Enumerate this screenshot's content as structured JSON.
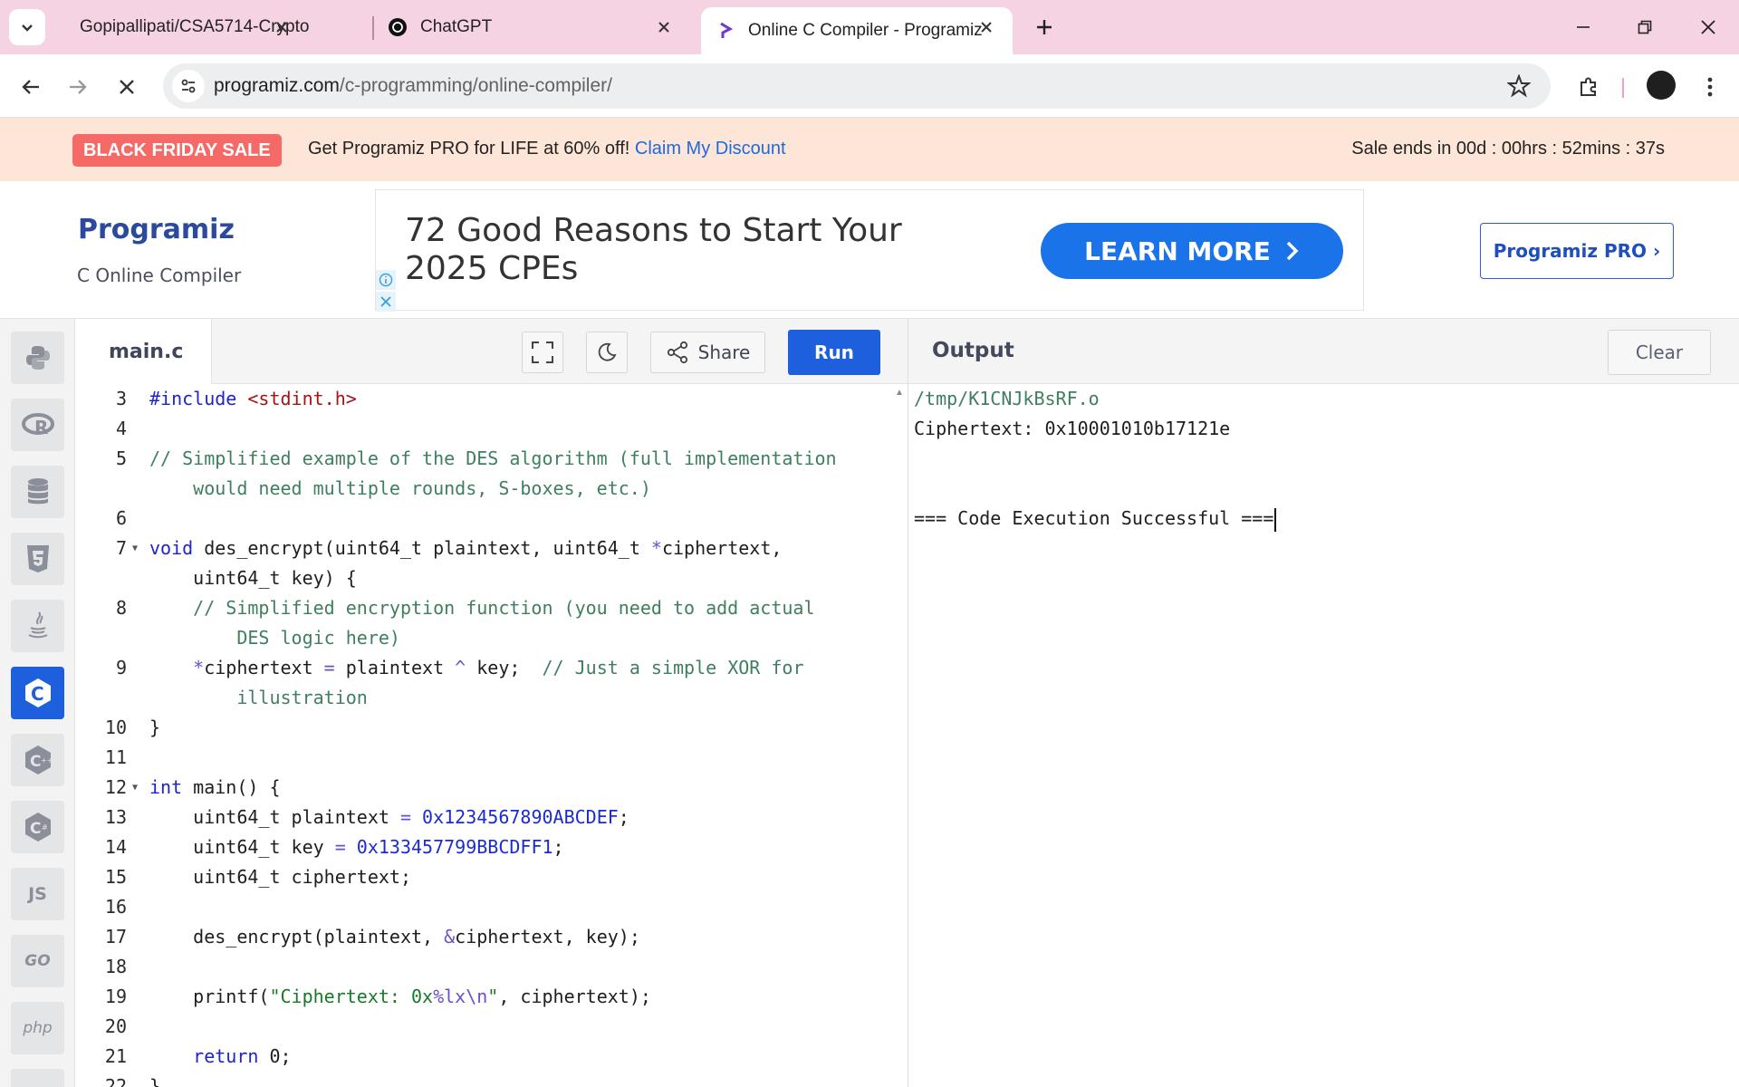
{
  "browser": {
    "tabs": [
      {
        "title": "Gopipallipati/CSA5714-Crypto",
        "icon": "github-icon"
      },
      {
        "title": "ChatGPT",
        "icon": "chatgpt-icon"
      },
      {
        "title": "Online C Compiler - Programiz",
        "icon": "programiz-icon",
        "active": true
      }
    ],
    "url_host": "programiz.com",
    "url_path": "/c-programming/online-compiler/"
  },
  "promo": {
    "badge": "BLACK FRIDAY SALE",
    "message": "Get Programiz PRO for LIFE at 60% off!",
    "link": "Claim My Discount",
    "timer": "Sale ends in 00d : 00hrs : 52mins : 37s"
  },
  "header": {
    "logo": "Programiz",
    "subtitle": "C Online Compiler",
    "ad_text": "72 Good Reasons to Start Your 2025 CPEs",
    "ad_cta": "LEARN MORE",
    "pro_button": "Programiz PRO ›"
  },
  "languages": [
    "python",
    "r",
    "sql",
    "html",
    "java",
    "c",
    "c++",
    "c#",
    "JS",
    "GO",
    "php"
  ],
  "editor": {
    "file_name": "main.c",
    "share_label": "Share",
    "run_label": "Run",
    "lines": [
      {
        "n": "3",
        "text": "#include <stdint.h>"
      },
      {
        "n": "4",
        "text": ""
      },
      {
        "n": "5",
        "text": "// Simplified example of the DES algorithm (full implementation"
      },
      {
        "n": "",
        "text": "    would need multiple rounds, S-boxes, etc.)"
      },
      {
        "n": "6",
        "text": ""
      },
      {
        "n": "7",
        "text": "void des_encrypt(uint64_t plaintext, uint64_t *ciphertext,"
      },
      {
        "n": "",
        "text": "    uint64_t key) {"
      },
      {
        "n": "8",
        "text": "    // Simplified encryption function (you need to add actual"
      },
      {
        "n": "",
        "text": "        DES logic here)"
      },
      {
        "n": "9",
        "text": "    *ciphertext = plaintext ^ key;  // Just a simple XOR for"
      },
      {
        "n": "",
        "text": "        illustration"
      },
      {
        "n": "10",
        "text": "}"
      },
      {
        "n": "11",
        "text": ""
      },
      {
        "n": "12",
        "text": "int main() {"
      },
      {
        "n": "13",
        "text": "    uint64_t plaintext = 0x1234567890ABCDEF;"
      },
      {
        "n": "14",
        "text": "    uint64_t key = 0x133457799BBCDFF1;"
      },
      {
        "n": "15",
        "text": "    uint64_t ciphertext;"
      },
      {
        "n": "16",
        "text": ""
      },
      {
        "n": "17",
        "text": "    des_encrypt(plaintext, &ciphertext, key);"
      },
      {
        "n": "18",
        "text": ""
      },
      {
        "n": "19",
        "text": "    printf(\"Ciphertext: 0x%lx\\n\", ciphertext);"
      },
      {
        "n": "20",
        "text": ""
      },
      {
        "n": "21",
        "text": "    return 0;"
      },
      {
        "n": "22",
        "text": "}"
      }
    ]
  },
  "output": {
    "title": "Output",
    "clear_label": "Clear",
    "path_line": "/tmp/K1CNJkBsRF.o",
    "result_line": "Ciphertext: 0x10001010b17121e",
    "status_line": "=== Code Execution Successful ==="
  }
}
